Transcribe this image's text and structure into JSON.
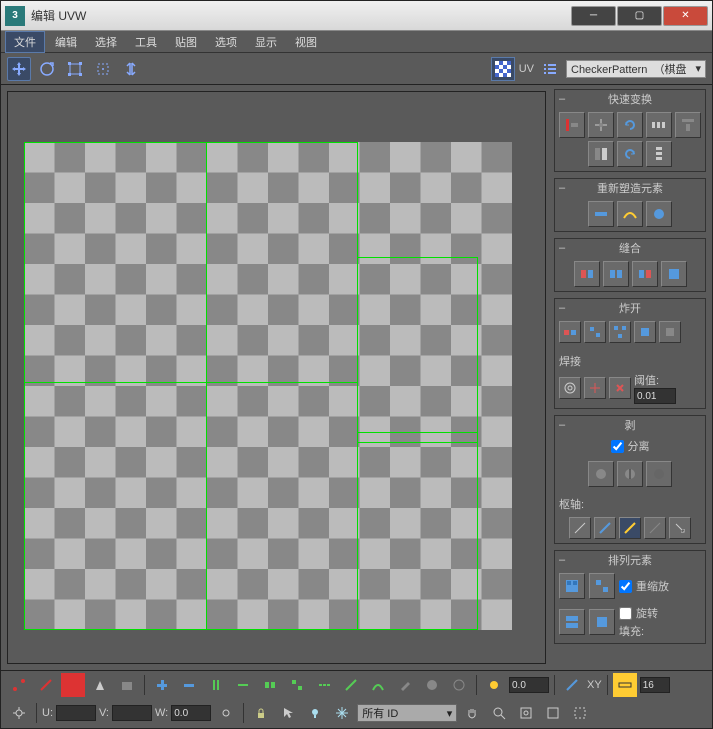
{
  "titlebar": {
    "title": "编辑 UVW"
  },
  "menu": {
    "file": "文件",
    "edit": "编辑",
    "select": "选择",
    "tools": "工具",
    "map": "贴图",
    "options": "选项",
    "display": "显示",
    "view": "视图"
  },
  "toolbar": {
    "uv_label": "UV",
    "dropdown_text": "CheckerPattern",
    "dropdown_opt": "（棋盘"
  },
  "panels": {
    "quicktrans": {
      "title": "快速变换"
    },
    "reshape": {
      "title": "重新塑造元素"
    },
    "stitch": {
      "title": "缝合"
    },
    "explode": {
      "title": "炸开",
      "weld": "焊接",
      "threshold": "阈值:",
      "threshold_val": "0.01"
    },
    "peel": {
      "title": "剥",
      "detach": "分离",
      "pivot": "枢轴:"
    },
    "arrange": {
      "title": "排列元素",
      "rescale": "重缩放",
      "rotate": "旋转",
      "fill": "填充:"
    }
  },
  "bottom": {
    "val0": "0.0",
    "xy": "XY",
    "spinner": "16",
    "u": "U:",
    "v": "V:",
    "w": "W:",
    "w_val": "0.0",
    "all_id": "所有 ID"
  }
}
